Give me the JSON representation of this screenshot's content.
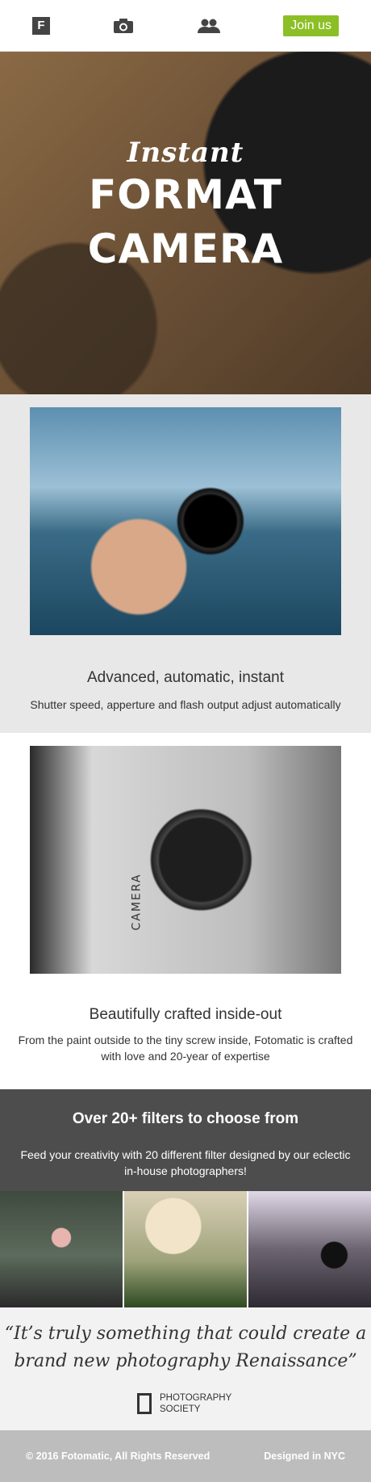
{
  "nav": {
    "logo_letter": "F",
    "camera_icon": "camera-icon",
    "people_icon": "people-icon",
    "join_label": "Join us",
    "accent_color": "#8cbf26"
  },
  "hero": {
    "script_text": "Instant",
    "title_line1": "FORMAT",
    "title_line2": "CAMERA"
  },
  "features": [
    {
      "title": "Advanced, automatic, instant",
      "description": "Shutter speed, apperture and flash output adjust automatically"
    },
    {
      "title": "Beautifully crafted inside-out",
      "description": "From the paint outside to the tiny screw inside, Fotomatic is crafted with love and 20-year of expertise",
      "photo_text": "CAMERA"
    }
  ],
  "filters": {
    "title": "Over 20+ filters to choose from",
    "description": "Feed your creativity with 20 different filter designed by our eclectic in-house photographers!"
  },
  "quote": {
    "text": "“It’s truly something that could create a brand new photography Renaissance”",
    "source_line1": "PHOTOGRAPHY",
    "source_line2": "SOCIETY"
  },
  "footer": {
    "left": "© 2016 Fotomatic, All Rights Reserved",
    "right": "Designed in NYC"
  }
}
